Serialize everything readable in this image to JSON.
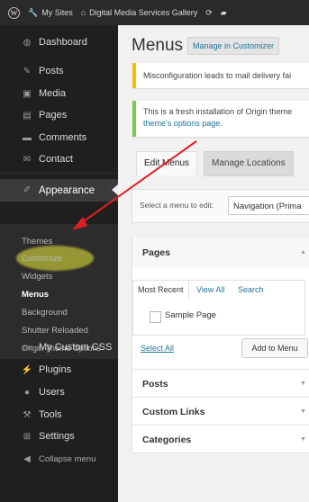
{
  "adminbar": {
    "my_sites": "My Sites",
    "site_name": "Digital Media Services Gallery"
  },
  "sidebar": {
    "items": [
      {
        "label": "Dashboard",
        "icon": "dashboard-icon"
      },
      {
        "label": "Posts",
        "icon": "pin-icon"
      },
      {
        "label": "Media",
        "icon": "media-icon"
      },
      {
        "label": "Pages",
        "icon": "pages-icon"
      },
      {
        "label": "Comments",
        "icon": "comment-icon"
      },
      {
        "label": "Contact",
        "icon": "mail-icon"
      },
      {
        "label": "Appearance",
        "icon": "brush-icon"
      },
      {
        "label": "My Custom CSS",
        "icon": "css-icon"
      },
      {
        "label": "Plugins",
        "icon": "plugin-icon"
      },
      {
        "label": "Users",
        "icon": "users-icon"
      },
      {
        "label": "Tools",
        "icon": "tools-icon"
      },
      {
        "label": "Settings",
        "icon": "settings-icon"
      },
      {
        "label": "Collapse menu",
        "icon": "collapse-icon"
      }
    ],
    "appearance_submenu": [
      "Themes",
      "Customize",
      "Widgets",
      "Menus",
      "Background",
      "Shutter Reloaded",
      "Origin Theme Options"
    ]
  },
  "main": {
    "title": "Menus",
    "manage_button": "Manage in Customizer",
    "notice_warning": "Misconfiguration leads to mail delivery fai",
    "notice_info_line1": "This is a fresh installation of Origin theme",
    "notice_info_link": "theme's options page.",
    "tabs": [
      "Edit Menus",
      "Manage Locations"
    ],
    "select_label": "Select a menu to edit:",
    "select_value": "Navigation (Prima",
    "pages_panel": {
      "title": "Pages",
      "tabs": [
        "Most Recent",
        "View All",
        "Search"
      ],
      "item": "Sample Page",
      "select_all": "Select All",
      "add_button": "Add to Menu"
    },
    "other_panels": [
      "Posts",
      "Custom Links",
      "Categories"
    ]
  },
  "colors": {
    "sidebar_bg": "#1f1f1f",
    "link": "#21759b",
    "warning": "#ffba00",
    "success": "#7ad03a",
    "annotation_red": "#e02020",
    "highlight_yellow": "#eef03c"
  }
}
